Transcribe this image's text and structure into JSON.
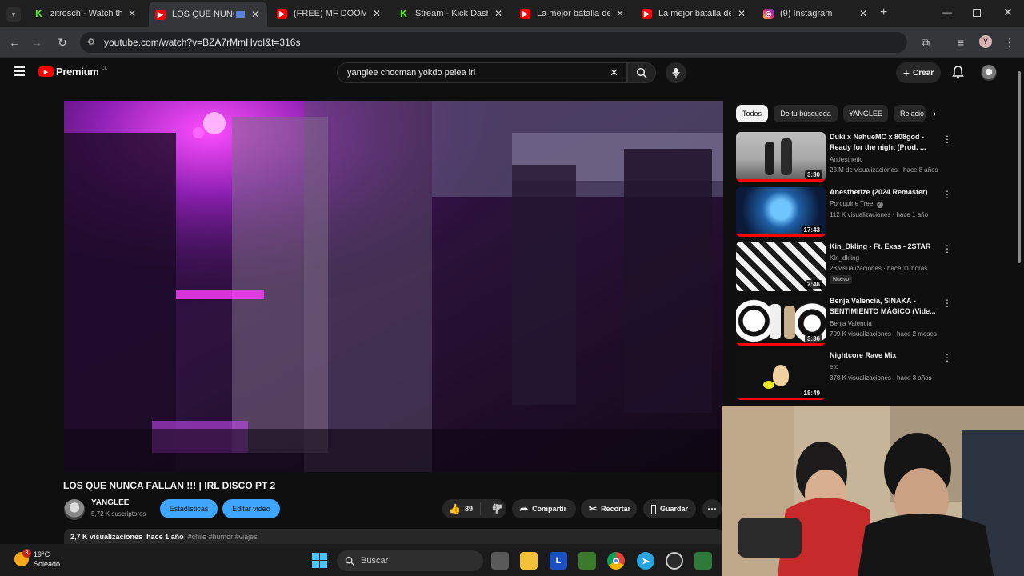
{
  "browser": {
    "tabs": [
      {
        "title": "zitrosch - Watch the",
        "favicon": "kick-icon",
        "active": false
      },
      {
        "title": "LOS QUE NUNCA",
        "favicon": "youtube-icon",
        "active": true
      },
      {
        "title": "(FREE) MF DOOM x J",
        "favicon": "youtube-icon",
        "active": false
      },
      {
        "title": "Stream - Kick Dashb",
        "favicon": "kick-icon",
        "active": false
      },
      {
        "title": "La mejor batalla de r",
        "favicon": "youtube-icon",
        "active": false
      },
      {
        "title": "La mejor batalla de r",
        "favicon": "youtube-icon",
        "active": false
      },
      {
        "title": "(9) Instagram",
        "favicon": "instagram-icon",
        "active": false
      }
    ],
    "url": "youtube.com/watch?v=BZA7rMmHvol&t=316s",
    "profile_initial": "Y"
  },
  "yt_header": {
    "logo_text": "Premium",
    "region": "CL",
    "search_query": "yanglee chocman yokdo pelea irl",
    "create_label": "Crear"
  },
  "video": {
    "title": "LOS QUE NUNCA FALLAN !!! | IRL DISCO PT 2",
    "channel": "YANGLEE",
    "subscribers": "5,72 K suscriptores",
    "stats_label": "Estadísticas",
    "edit_label": "Editar video",
    "likes": "89",
    "share_label": "Compartir",
    "clip_label": "Recortar",
    "save_label": "Guardar",
    "views": "2,7 K visualizaciones",
    "age": "hace 1 año",
    "tags": "#chile #humor #viajes"
  },
  "chips": [
    "Todos",
    "De tu búsqueda",
    "YANGLEE",
    "Relacio"
  ],
  "recommendations": [
    {
      "title": "Duki x NahueMC x 808god - Ready for the night (Prod. ...",
      "channel": "Antiesthetic",
      "meta": "23 M de visualizaciones · hace 8 años",
      "duration": "3:30",
      "verified": false,
      "badge": ""
    },
    {
      "title": "Anesthetize (2024 Remaster)",
      "channel": "Porcupine Tree",
      "meta": "112 K visualizaciones · hace 1 año",
      "duration": "17:43",
      "verified": true,
      "badge": ""
    },
    {
      "title": "Kin_Dkling - Ft. Exas - 2STAR",
      "channel": "Kin_dkling",
      "meta": "28 visualizaciones · hace 11 horas",
      "duration": "2:46",
      "verified": false,
      "badge": "Nuevo"
    },
    {
      "title": "Benja Valencia, SINAKA - SENTIMIENTO MÁGICO (Vide...",
      "channel": "Benja Valencia",
      "meta": "799 K visualizaciones · hace 2 meses",
      "duration": "3:36",
      "verified": false,
      "badge": ""
    },
    {
      "title": "Nightcore Rave Mix",
      "channel": "eto",
      "meta": "378 K visualizaciones · hace 3 años",
      "duration": "18:49",
      "verified": false,
      "badge": ""
    }
  ],
  "taskbar": {
    "search_placeholder": "Buscar",
    "weather_temp": "19°C",
    "weather_desc": "Soleado",
    "weather_badge": "3"
  },
  "colors": {
    "youtube_red": "#ff0000",
    "accent_blue": "#3ea6ff",
    "background": "#0f0f0f"
  }
}
